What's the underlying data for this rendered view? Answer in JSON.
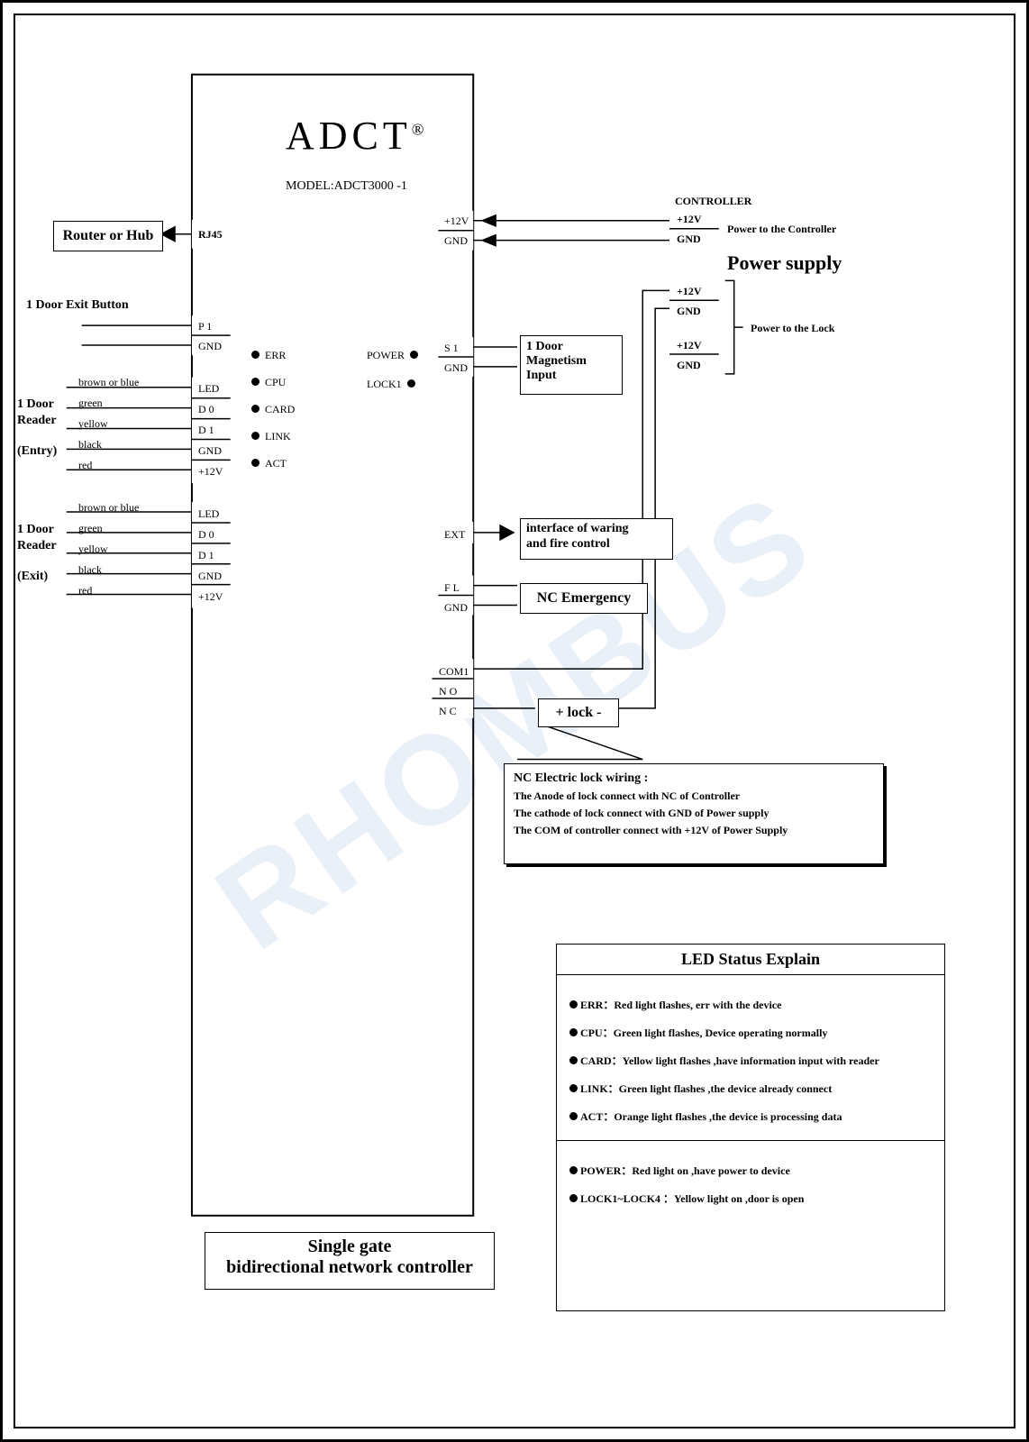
{
  "brand": "ADCT",
  "reg": "®",
  "model_label": "MODEL:ADCT3000 -1",
  "router": "Router or Hub",
  "rj45": "RJ45",
  "exit_btn_label": "1 Door Exit Button",
  "p1": "P 1",
  "gnd": "GND",
  "plus12v": "+12V",
  "reader_entry_title1": "1 Door",
  "reader_entry_title2": "Reader",
  "reader_entry_sub": "(Entry)",
  "reader_exit_title1": "1 Door",
  "reader_exit_title2": "Reader",
  "reader_exit_sub": "(Exit)",
  "wire_brownblue": "brown or blue",
  "wire_green": "green",
  "wire_yellow": "yellow",
  "wire_black": "black",
  "wire_red": "red",
  "pin_led": "LED",
  "pin_d0": "D 0",
  "pin_d1": "D 1",
  "pin_gnd": "GND",
  "pin_12v": "+12V",
  "led_err": "ERR",
  "led_cpu": "CPU",
  "led_card": "CARD",
  "led_link": "LINK",
  "led_act": "ACT",
  "led_power": "POWER",
  "led_lock1": "LOCK1",
  "right_12v": "+12V",
  "right_gnd": "GND",
  "s1": "S 1",
  "ext": "EXT",
  "fl": "F L",
  "com1": "COM1",
  "no": "N O",
  "nc": "N C",
  "magnetism_l1": "1 Door",
  "magnetism_l2": "Magnetism",
  "magnetism_l3": "Input",
  "waring_l1": "interface of waring",
  "waring_l2": "and fire control",
  "nc_emerg": "NC Emergency",
  "lock_box": "+   lock   -",
  "controller_label": "CONTROLLER",
  "power_to_controller": "Power to the Controller",
  "power_supply": "Power supply",
  "power_to_lock": "Power to the Lock",
  "note_title": "NC Electric lock wiring :",
  "note_l1": "The Anode of lock connect with NC of Controller",
  "note_l2": "The cathode of lock connect with GND of Power supply",
  "note_l3": "The COM of controller connect with +12V of Power Supply",
  "caption_l1": "Single gate",
  "caption_l2": "bidirectional network controller",
  "legend_title": "LED Status Explain",
  "legend_err": "ERR：Red light flashes, err with the device",
  "legend_cpu": "CPU：Green light flashes, Device operating normally",
  "legend_card": "CARD：Yellow light flashes ,have information input with reader",
  "legend_link": "LINK：Green light flashes ,the device already connect",
  "legend_act": "ACT：Orange light flashes ,the device is processing data",
  "legend_power": "POWER：Red light on ,have power to device",
  "legend_lock": "LOCK1~LOCK4 ：Yellow light on ,door is open"
}
